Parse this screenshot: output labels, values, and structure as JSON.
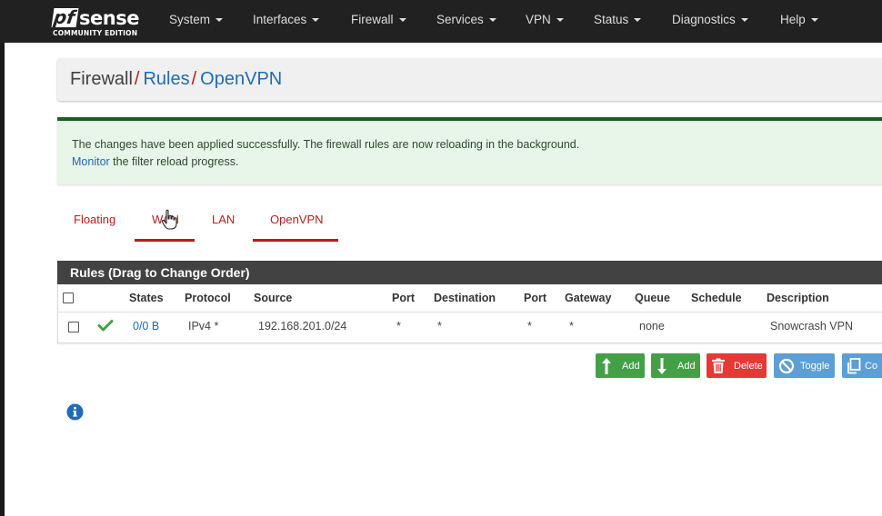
{
  "app": {
    "logo_text_main": "sense",
    "logo_text_pf": "pf",
    "logo_subtitle": "COMMUNITY EDITION"
  },
  "nav": {
    "items": [
      {
        "label": "System"
      },
      {
        "label": "Interfaces"
      },
      {
        "label": "Firewall"
      },
      {
        "label": "Services"
      },
      {
        "label": "VPN"
      },
      {
        "label": "Status"
      },
      {
        "label": "Diagnostics"
      },
      {
        "label": "Help"
      }
    ]
  },
  "breadcrumb": {
    "root": "Firewall",
    "sep": "/",
    "level1": "Rules",
    "level2": "OpenVPN"
  },
  "alert": {
    "line1": "The changes have been applied successfully. The firewall rules are now reloading in the background.",
    "link": "Monitor",
    "line2_rest": " the filter reload progress."
  },
  "tabs": [
    {
      "label": "Floating",
      "active": false
    },
    {
      "label": "WAN",
      "active": false
    },
    {
      "label": "LAN",
      "active": false
    },
    {
      "label": "OpenVPN",
      "active": true
    }
  ],
  "rules_panel": {
    "title": "Rules (Drag to Change Order)",
    "columns": [
      "States",
      "Protocol",
      "Source",
      "Port",
      "Destination",
      "Port",
      "Gateway",
      "Queue",
      "Schedule",
      "Description"
    ],
    "rows": [
      {
        "states": "0/0 B",
        "protocol": "IPv4 *",
        "source": "192.168.201.0/24",
        "source_port": "*",
        "destination": "*",
        "dest_port": "*",
        "gateway": "*",
        "queue": "none",
        "schedule": "",
        "description": "Snowcrash VPN",
        "enabled_icon": "check-icon"
      }
    ]
  },
  "buttons": {
    "add_top": "Add",
    "add_bottom": "Add",
    "delete": "Delete",
    "toggle": "Toggle",
    "copy": "Co"
  },
  "colors": {
    "navbar": "#212121",
    "accent_red": "#b71c1c",
    "link_blue": "#1e6bb8",
    "success_green": "#43a047",
    "danger_red": "#e53935",
    "info_blue": "#5c9fd6"
  }
}
